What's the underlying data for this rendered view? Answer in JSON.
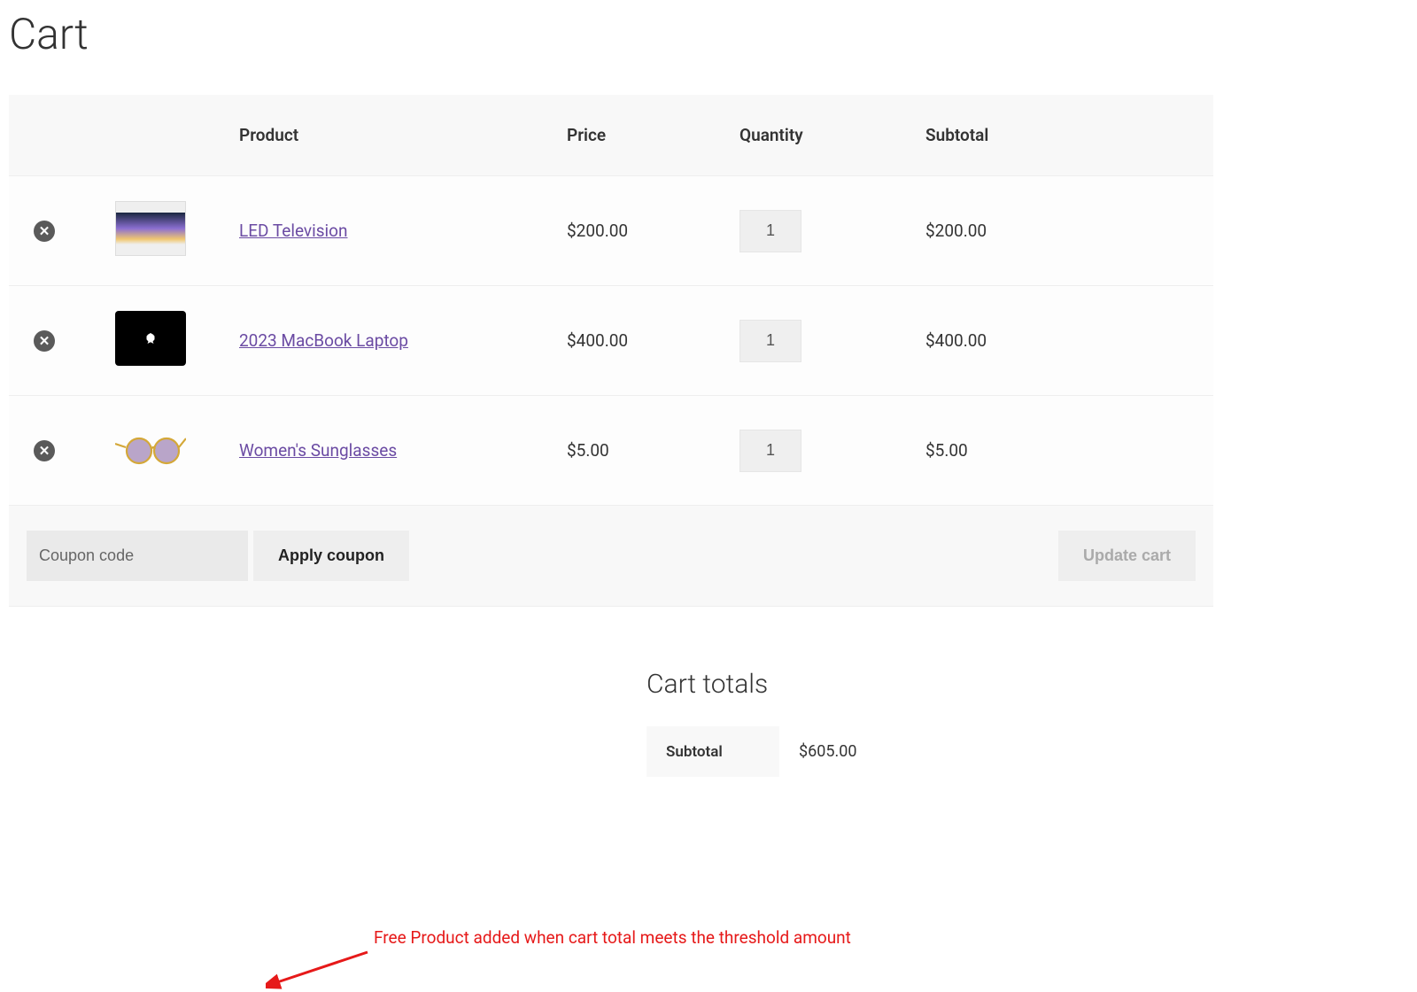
{
  "page_title": "Cart",
  "headers": {
    "product": "Product",
    "price": "Price",
    "quantity": "Quantity",
    "subtotal": "Subtotal"
  },
  "items": [
    {
      "name": "LED Television",
      "price": "$200.00",
      "qty": "1",
      "subtotal": "$200.00"
    },
    {
      "name": "2023 MacBook Laptop",
      "price": "$400.00",
      "qty": "1",
      "subtotal": "$400.00"
    },
    {
      "name": "Women's Sunglasses",
      "price": "$5.00",
      "qty": "1",
      "subtotal": "$5.00"
    }
  ],
  "coupon": {
    "placeholder": "Coupon code",
    "apply_label": "Apply coupon"
  },
  "update_label": "Update cart",
  "annotation": "Free Product added when cart total meets the threshold amount",
  "totals": {
    "title": "Cart totals",
    "subtotal_label": "Subtotal",
    "subtotal_value": "$605.00"
  }
}
